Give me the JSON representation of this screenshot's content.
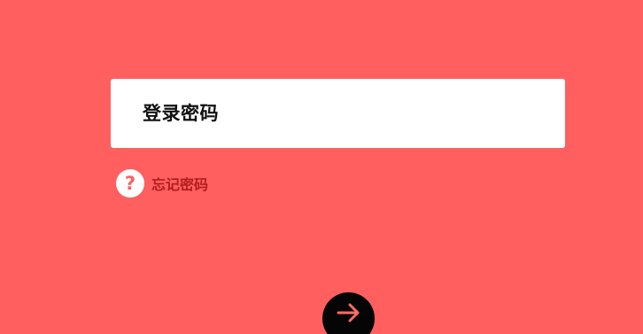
{
  "colors": {
    "background": "#ff5f5f",
    "field_background": "#ffffff",
    "forgot_text": "#b31d1d",
    "help_icon_glyph": "#ff5f5f",
    "submit_button": "#050505",
    "submit_arrow": "#ff6b66"
  },
  "login": {
    "password_placeholder": "登录密码",
    "forgot_password_label": "忘记密码",
    "help_icon_glyph": "?",
    "help_icon": "question-circle-icon",
    "submit_icon": "arrow-right-icon"
  }
}
